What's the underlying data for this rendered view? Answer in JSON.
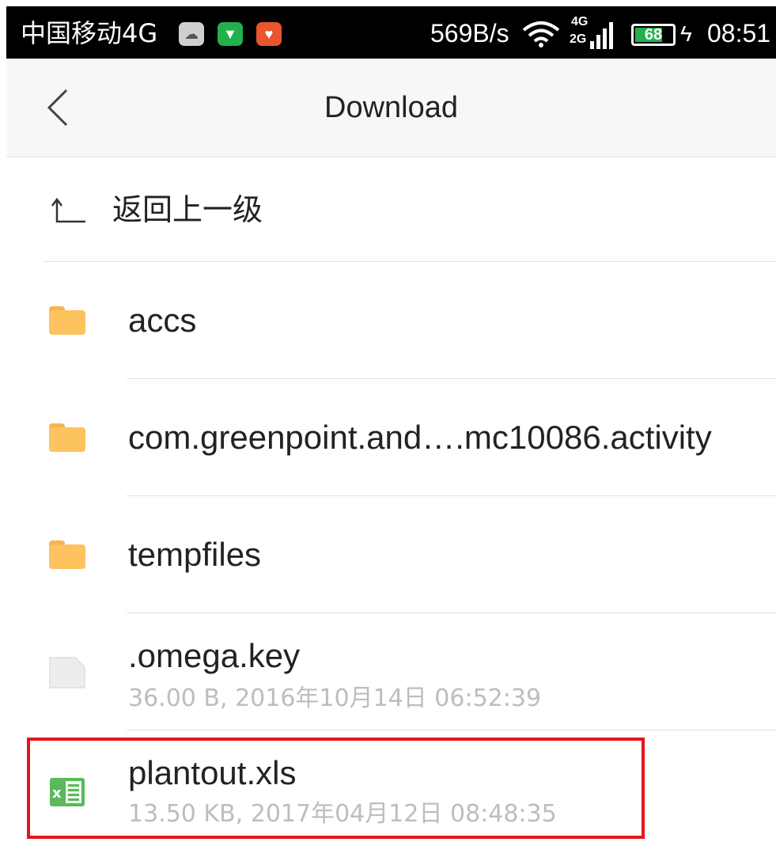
{
  "status_bar": {
    "carrier": "中国移动4G",
    "net_speed": "569B/s",
    "network_top": "4G",
    "network_bottom": "2G",
    "battery": "68",
    "time": "08:51",
    "app_icons": [
      "cloud-app-icon",
      "green-app-icon",
      "health-app-icon"
    ]
  },
  "header": {
    "title": "Download",
    "back_icon": "chevron-left-icon"
  },
  "list": {
    "parent_label": "返回上一级",
    "items": [
      {
        "name": "accs",
        "type": "folder"
      },
      {
        "name": "com.greenpoint.and….mc10086.activity",
        "type": "folder"
      },
      {
        "name": "tempfiles",
        "type": "folder"
      },
      {
        "name": ".omega.key",
        "type": "file",
        "meta": "36.00 B, 2016年10月14日  06:52:39"
      },
      {
        "name": "plantout.xls",
        "type": "xls",
        "meta": "13.50 KB, 2017年04月12日  08:48:35"
      }
    ]
  },
  "colors": {
    "folder": "#fdc35f",
    "highlight": "#e5161a",
    "excel": "#4caf50"
  }
}
